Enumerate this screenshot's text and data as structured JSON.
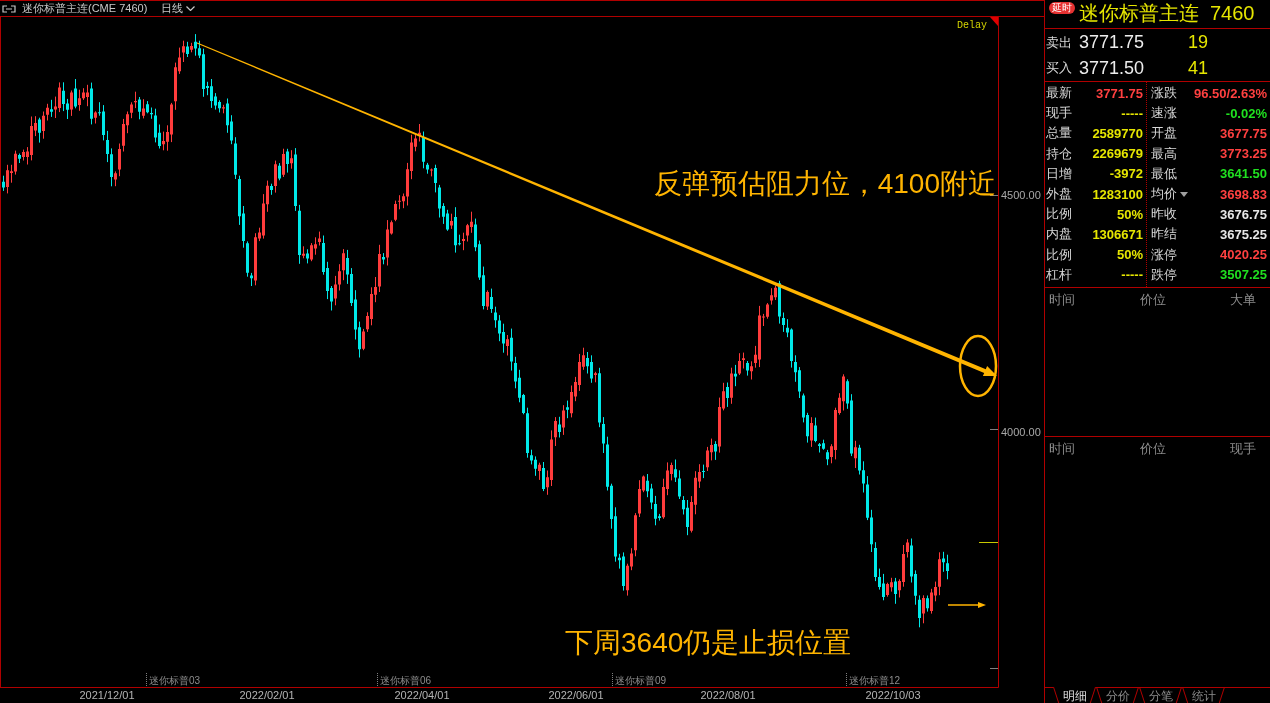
{
  "chart_header": {
    "title": "迷你标普主连(CME 7460)",
    "period": "日线"
  },
  "chart": {
    "status": "Delay",
    "y_axis": [
      "4500.00",
      "4000.00"
    ],
    "annotations": [
      "反弹预估阻力位，4100附近",
      "下周3640仍是止损位置"
    ],
    "contracts": [
      "迷你标普03",
      "迷你标普06",
      "迷你标普09",
      "迷你标普12"
    ],
    "x_axis": [
      "2021/12/01",
      "2022/02/01",
      "2022/04/01",
      "2022/06/01",
      "2022/08/01",
      "2022/10/03"
    ]
  },
  "quote": {
    "badge": "延时",
    "name": "迷你标普主连",
    "code": "7460",
    "order_book": [
      {
        "label": "卖出",
        "price": "3771.75",
        "volume": "19"
      },
      {
        "label": "买入",
        "price": "3771.50",
        "volume": "41"
      }
    ],
    "stats_left": [
      {
        "label": "最新",
        "value": "3771.75",
        "color": "#ff4040"
      },
      {
        "label": "现手",
        "value": "-----",
        "color": "#e6e600"
      },
      {
        "label": "总量",
        "value": "2589770",
        "color": "#e6e600"
      },
      {
        "label": "持仓",
        "value": "2269679",
        "color": "#e6e600"
      },
      {
        "label": "日增",
        "value": "-3972",
        "color": "#e6e600"
      },
      {
        "label": "外盘",
        "value": "1283100",
        "color": "#e6e600"
      },
      {
        "label": "比例",
        "value": "50%",
        "color": "#e6e600"
      },
      {
        "label": "内盘",
        "value": "1306671",
        "color": "#e6e600"
      },
      {
        "label": "比例",
        "value": "50%",
        "color": "#e6e600"
      },
      {
        "label": "杠杆",
        "value": "-----",
        "color": "#e6e600"
      }
    ],
    "stats_right": [
      {
        "label": "涨跌",
        "value": "96.50/2.63%",
        "color": "#ff4040",
        "dropdown": false
      },
      {
        "label": "速涨",
        "value": "-0.02%",
        "color": "#20e020",
        "dropdown": false
      },
      {
        "label": "开盘",
        "value": "3677.75",
        "color": "#ff4040",
        "dropdown": false
      },
      {
        "label": "最高",
        "value": "3773.25",
        "color": "#ff4040",
        "dropdown": false
      },
      {
        "label": "最低",
        "value": "3641.50",
        "color": "#20e020",
        "dropdown": false
      },
      {
        "label": "均价",
        "value": "3698.83",
        "color": "#ff4040",
        "dropdown": true
      },
      {
        "label": "昨收",
        "value": "3676.75",
        "color": "#e6e6e6",
        "dropdown": false
      },
      {
        "label": "昨结",
        "value": "3675.25",
        "color": "#e6e6e6",
        "dropdown": false
      },
      {
        "label": "涨停",
        "value": "4020.25",
        "color": "#ff4040",
        "dropdown": false
      },
      {
        "label": "跌停",
        "value": "3507.25",
        "color": "#20e020",
        "dropdown": false
      }
    ],
    "trade_lists": [
      {
        "columns": [
          "时间",
          "价位",
          "大单"
        ]
      },
      {
        "columns": [
          "时间",
          "价位",
          "现手"
        ]
      }
    ],
    "tabs": [
      {
        "label": "明细",
        "selected": true
      },
      {
        "label": "分价",
        "selected": false
      },
      {
        "label": "分笔",
        "selected": false
      },
      {
        "label": "统计",
        "selected": false
      }
    ]
  }
}
